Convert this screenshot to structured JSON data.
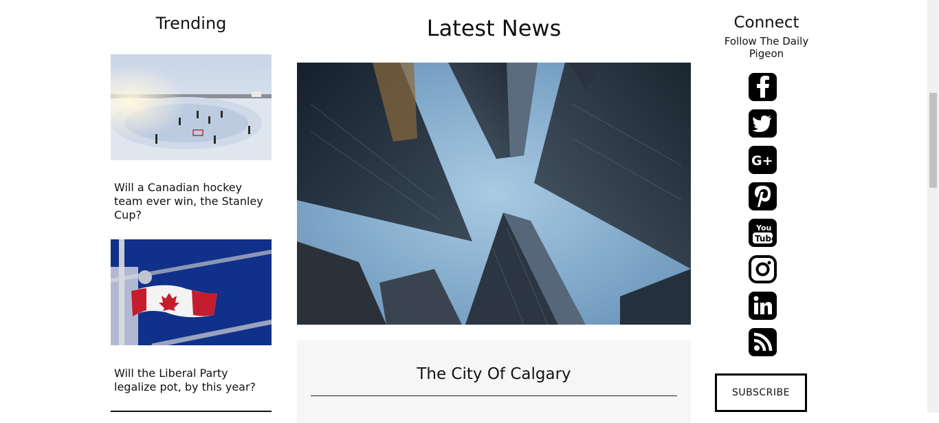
{
  "trending": {
    "title": "Trending",
    "items": [
      {
        "caption": "Will a Canadian hockey team ever win, the Stanley Cup?",
        "image": "outdoor-rink-photo"
      },
      {
        "caption": "Will the Liberal Party legalize pot, by this year?",
        "image": "canada-flag-photo"
      }
    ]
  },
  "latest": {
    "title": "Latest News",
    "hero_image": "skyscrapers-photo",
    "article": {
      "title": "The City Of Calgary",
      "excerpt": ""
    }
  },
  "connect": {
    "title": "Connect",
    "subtitle": "Follow The Daily Pigeon",
    "icons": [
      "facebook-icon",
      "twitter-icon",
      "google-plus-icon",
      "pinterest-icon",
      "youtube-icon",
      "instagram-icon",
      "linkedin-icon",
      "rss-icon"
    ],
    "subscribe_label": "SUBSCRIBE"
  },
  "colors": {
    "text": "#111111",
    "card_bg": "#f6f6f6",
    "icon_bg": "#000000"
  }
}
